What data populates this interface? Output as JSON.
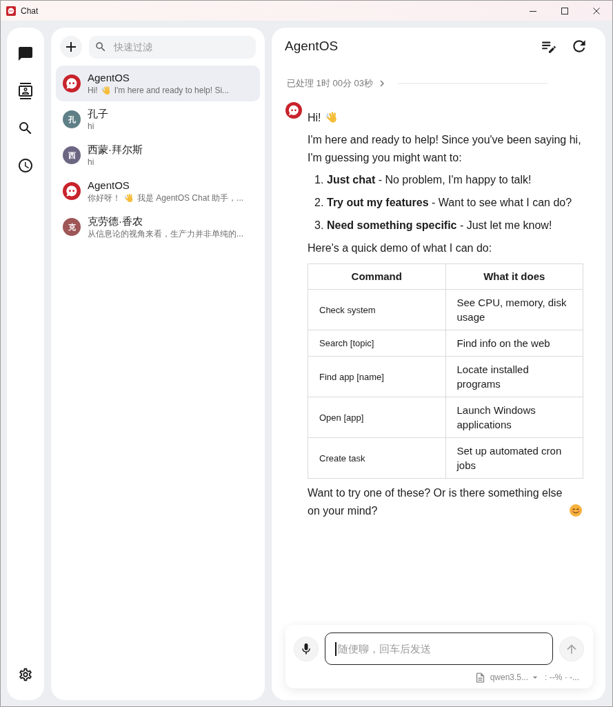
{
  "window": {
    "title": "Chat"
  },
  "conversations": {
    "search": {
      "placeholder": "快速过滤"
    },
    "items": [
      {
        "name": "AgentOS",
        "kind": "bot",
        "selected": true,
        "preview": [
          {
            "kind": "text",
            "text": "Hi!"
          },
          {
            "kind": "wave"
          },
          {
            "kind": "text",
            "text": "I'm here and ready to help! Si..."
          }
        ]
      },
      {
        "name": "孔子",
        "kind": "letter",
        "avatar": "孔",
        "color": "#5f7f86",
        "selected": false,
        "preview": [
          {
            "kind": "text",
            "text": "hi"
          }
        ]
      },
      {
        "name": "西蒙·拜尔斯",
        "kind": "letter",
        "avatar": "西",
        "color": "#6c6682",
        "selected": false,
        "preview": [
          {
            "kind": "text",
            "text": "hi"
          }
        ]
      },
      {
        "name": "AgentOS",
        "kind": "bot",
        "selected": false,
        "preview": [
          {
            "kind": "text",
            "text": "你好呀！"
          },
          {
            "kind": "wave"
          },
          {
            "kind": "text",
            "text": "我是 AgentOS Chat 助手，..."
          }
        ]
      },
      {
        "name": "克劳德·香农",
        "kind": "letter",
        "avatar": "克",
        "color": "#9e5656",
        "selected": false,
        "preview": [
          {
            "kind": "text",
            "text": "从信息论的视角来看，生产力并非单纯的..."
          }
        ]
      }
    ]
  },
  "chat": {
    "title": "AgentOS",
    "status": "已处理 1时 00分 03秒",
    "blocks": [
      {
        "kind": "paragraph",
        "parts": [
          {
            "kind": "text",
            "text": "Hi!"
          },
          {
            "kind": "wave"
          }
        ]
      },
      {
        "kind": "paragraph",
        "parts": [
          {
            "kind": "text",
            "text": "I'm here and ready to help! Since you've been saying hi, I'm guessing you might want to:"
          }
        ]
      },
      {
        "kind": "list",
        "items": [
          {
            "number": "1.",
            "text": "**Just chat** - No problem, I'm happy to talk!"
          },
          {
            "number": "2.",
            "text": "**Try out my features** - Want to see what I can do?"
          },
          {
            "number": "3.",
            "text": "**Need something specific** - Just let me know!"
          }
        ]
      },
      {
        "kind": "paragraph",
        "parts": [
          {
            "kind": "text",
            "text": "Here's a quick demo of what I can do:"
          }
        ]
      },
      {
        "kind": "table",
        "columns": [
          "Command",
          "What it does"
        ],
        "rows": [
          [
            "Check system",
            "See CPU, memory, disk usage"
          ],
          [
            "Search [topic]",
            "Find info on the web"
          ],
          [
            "Find app [name]",
            "Locate installed programs"
          ],
          [
            "Open [app]",
            "Launch Windows applications"
          ],
          [
            "Create task",
            "Set up automated cron jobs"
          ]
        ]
      },
      {
        "kind": "paragraph",
        "parts": [
          {
            "kind": "text",
            "text": "Want to try one of these? Or is there something else on your mind?"
          },
          {
            "kind": "smile"
          }
        ]
      }
    ],
    "composer": {
      "placeholder": "随便聊，回车后发送",
      "focused": true,
      "send": {
        "disabled": true
      },
      "model": "qwen3.5...",
      "stats": ": --% · -..."
    }
  }
}
